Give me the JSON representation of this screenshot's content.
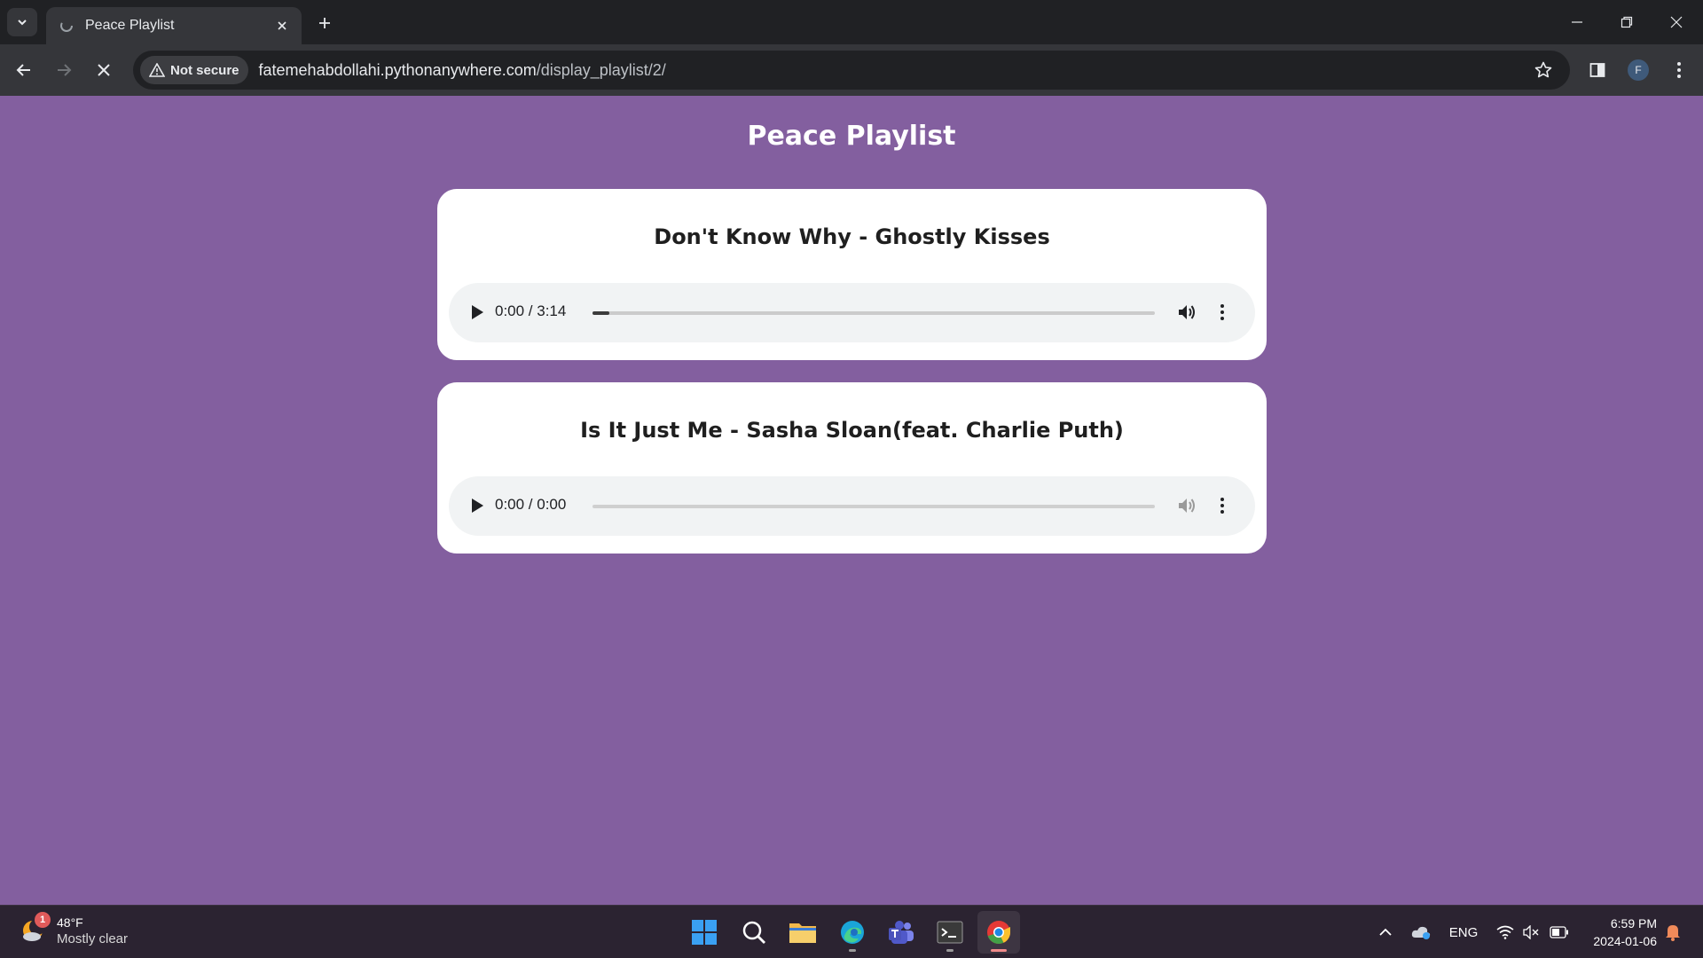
{
  "browser": {
    "tab_title": "Peace Playlist",
    "security_label": "Not secure",
    "url_host": "fatemehabdollahi.pythonanywhere.com",
    "url_path": "/display_playlist/2/",
    "profile_initial": "F"
  },
  "page": {
    "title": "Peace Playlist",
    "background_color": "#835f9f",
    "songs": [
      {
        "title": "Don't Know Why - Ghostly Kisses",
        "time": "0:00 / 3:14",
        "progress": 0.03,
        "loaded": true
      },
      {
        "title": "Is It Just Me - Sasha Sloan(feat. Charlie Puth)",
        "time": "0:00 / 0:00",
        "progress": 0,
        "loaded": false
      }
    ]
  },
  "taskbar": {
    "weather_temp": "48°F",
    "weather_condition": "Mostly clear",
    "weather_badge": "1",
    "language": "ENG",
    "time": "6:59 PM",
    "date": "2024-01-06",
    "apps": [
      "start-icon",
      "search-icon",
      "file-explorer-icon",
      "edge-icon",
      "teams-icon",
      "terminal-icon",
      "chrome-icon"
    ]
  }
}
